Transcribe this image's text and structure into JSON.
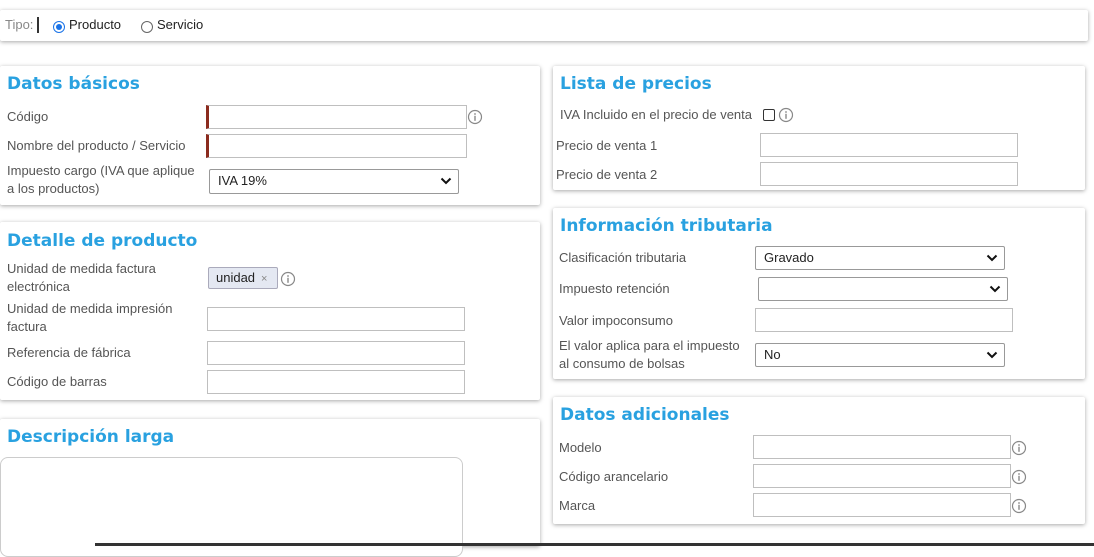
{
  "tipo": {
    "label": "Tipo:",
    "options": [
      "Producto",
      "Servicio"
    ],
    "selected": "Producto"
  },
  "datos_basicos": {
    "title": "Datos básicos",
    "codigo_label": "Código",
    "nombre_label": "Nombre del producto / Servicio",
    "impuesto_label_1": "Impuesto cargo (IVA que aplique",
    "impuesto_label_2": "a los productos)",
    "impuesto_value": "IVA 19%"
  },
  "detalle": {
    "title": "Detalle de producto",
    "unidad_fe_label_1": "Unidad de medida factura",
    "unidad_fe_label_2": "electrónica",
    "unidad_tag": "unidad",
    "unidad_tag_remove": "×",
    "unidad_imp_label_1": "Unidad de medida impresión",
    "unidad_imp_label_2": "factura",
    "referencia_label": "Referencia de fábrica",
    "barras_label": "Código de barras"
  },
  "descripcion": {
    "title": "Descripción larga"
  },
  "precios": {
    "title": "Lista de precios",
    "iva_label": "IVA Incluido en el precio de venta",
    "precio1_label": "Precio de venta 1",
    "precio2_label": "Precio de venta 2"
  },
  "tributaria": {
    "title": "Información tributaria",
    "clasificacion_label": "Clasificación tributaria",
    "clasificacion_value": "Gravado",
    "retencion_label": "Impuesto retención",
    "retencion_value": "",
    "impoconsumo_label": "Valor impoconsumo",
    "bolsas_label_1": "El valor aplica para el impuesto",
    "bolsas_label_2": "al consumo de bolsas",
    "bolsas_value": "No"
  },
  "adicionales": {
    "title": "Datos adicionales",
    "modelo_label": "Modelo",
    "arancel_label": "Código arancelario",
    "marca_label": "Marca"
  },
  "colors": {
    "accent": "#29a1e0",
    "required": "#8b2b1e",
    "radio": "#1a73e8"
  }
}
